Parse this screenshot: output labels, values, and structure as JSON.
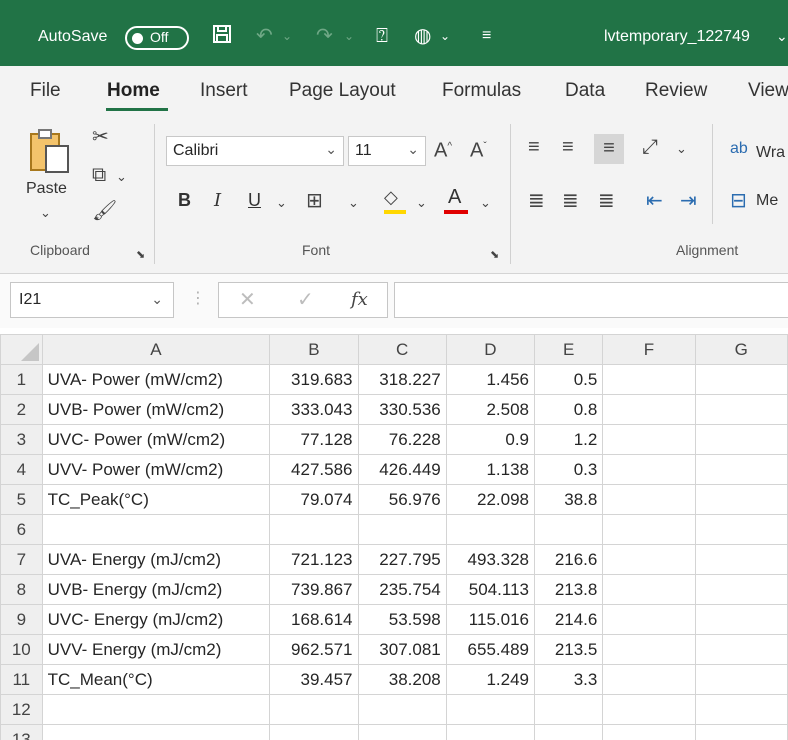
{
  "titlebar": {
    "autosave_label": "AutoSave",
    "autosave_state": "Off",
    "doc_title": "lvtemporary_122749",
    "colors": {
      "bg": "#217346"
    }
  },
  "tabs": [
    {
      "label": "File",
      "active": false
    },
    {
      "label": "Home",
      "active": true
    },
    {
      "label": "Insert",
      "active": false
    },
    {
      "label": "Page Layout",
      "active": false
    },
    {
      "label": "Formulas",
      "active": false
    },
    {
      "label": "Data",
      "active": false
    },
    {
      "label": "Review",
      "active": false
    },
    {
      "label": "View",
      "active": false
    }
  ],
  "ribbon": {
    "clipboard": {
      "paste_label": "Paste",
      "group_label": "Clipboard"
    },
    "font": {
      "name": "Calibri",
      "size": "11",
      "group_label": "Font"
    },
    "alignment": {
      "wrap_label": "Wra",
      "merge_label": "Me",
      "group_label": "Alignment"
    }
  },
  "formula_bar": {
    "name_box": "I21",
    "fx_label": "fx",
    "formula": ""
  },
  "grid": {
    "columns": [
      "A",
      "B",
      "C",
      "D",
      "E",
      "F",
      "G"
    ],
    "rows": [
      {
        "n": "1",
        "cells": [
          "UVA- Power (mW/cm2)",
          "319.683",
          "318.227",
          "1.456",
          "0.5",
          "",
          ""
        ]
      },
      {
        "n": "2",
        "cells": [
          "UVB- Power (mW/cm2)",
          "333.043",
          "330.536",
          "2.508",
          "0.8",
          "",
          ""
        ]
      },
      {
        "n": "3",
        "cells": [
          "UVC- Power (mW/cm2)",
          "77.128",
          "76.228",
          "0.9",
          "1.2",
          "",
          ""
        ]
      },
      {
        "n": "4",
        "cells": [
          "UVV- Power (mW/cm2)",
          "427.586",
          "426.449",
          "1.138",
          "0.3",
          "",
          ""
        ]
      },
      {
        "n": "5",
        "cells": [
          "TC_Peak(°C)",
          "79.074",
          "56.976",
          "22.098",
          "38.8",
          "",
          ""
        ]
      },
      {
        "n": "6",
        "cells": [
          "",
          "",
          "",
          "",
          "",
          "",
          ""
        ]
      },
      {
        "n": "7",
        "cells": [
          "UVA- Energy (mJ/cm2)",
          "721.123",
          "227.795",
          "493.328",
          "216.6",
          "",
          ""
        ]
      },
      {
        "n": "8",
        "cells": [
          "UVB- Energy (mJ/cm2)",
          "739.867",
          "235.754",
          "504.113",
          "213.8",
          "",
          ""
        ]
      },
      {
        "n": "9",
        "cells": [
          "UVC- Energy (mJ/cm2)",
          "168.614",
          "53.598",
          "115.016",
          "214.6",
          "",
          ""
        ]
      },
      {
        "n": "10",
        "cells": [
          "UVV- Energy (mJ/cm2)",
          "962.571",
          "307.081",
          "655.489",
          "213.5",
          "",
          ""
        ]
      },
      {
        "n": "11",
        "cells": [
          "TC_Mean(°C)",
          "39.457",
          "38.208",
          "1.249",
          "3.3",
          "",
          ""
        ]
      },
      {
        "n": "12",
        "cells": [
          "",
          "",
          "",
          "",
          "",
          "",
          ""
        ]
      },
      {
        "n": "13",
        "cells": [
          "",
          "",
          "",
          "",
          "",
          "",
          ""
        ]
      }
    ]
  }
}
